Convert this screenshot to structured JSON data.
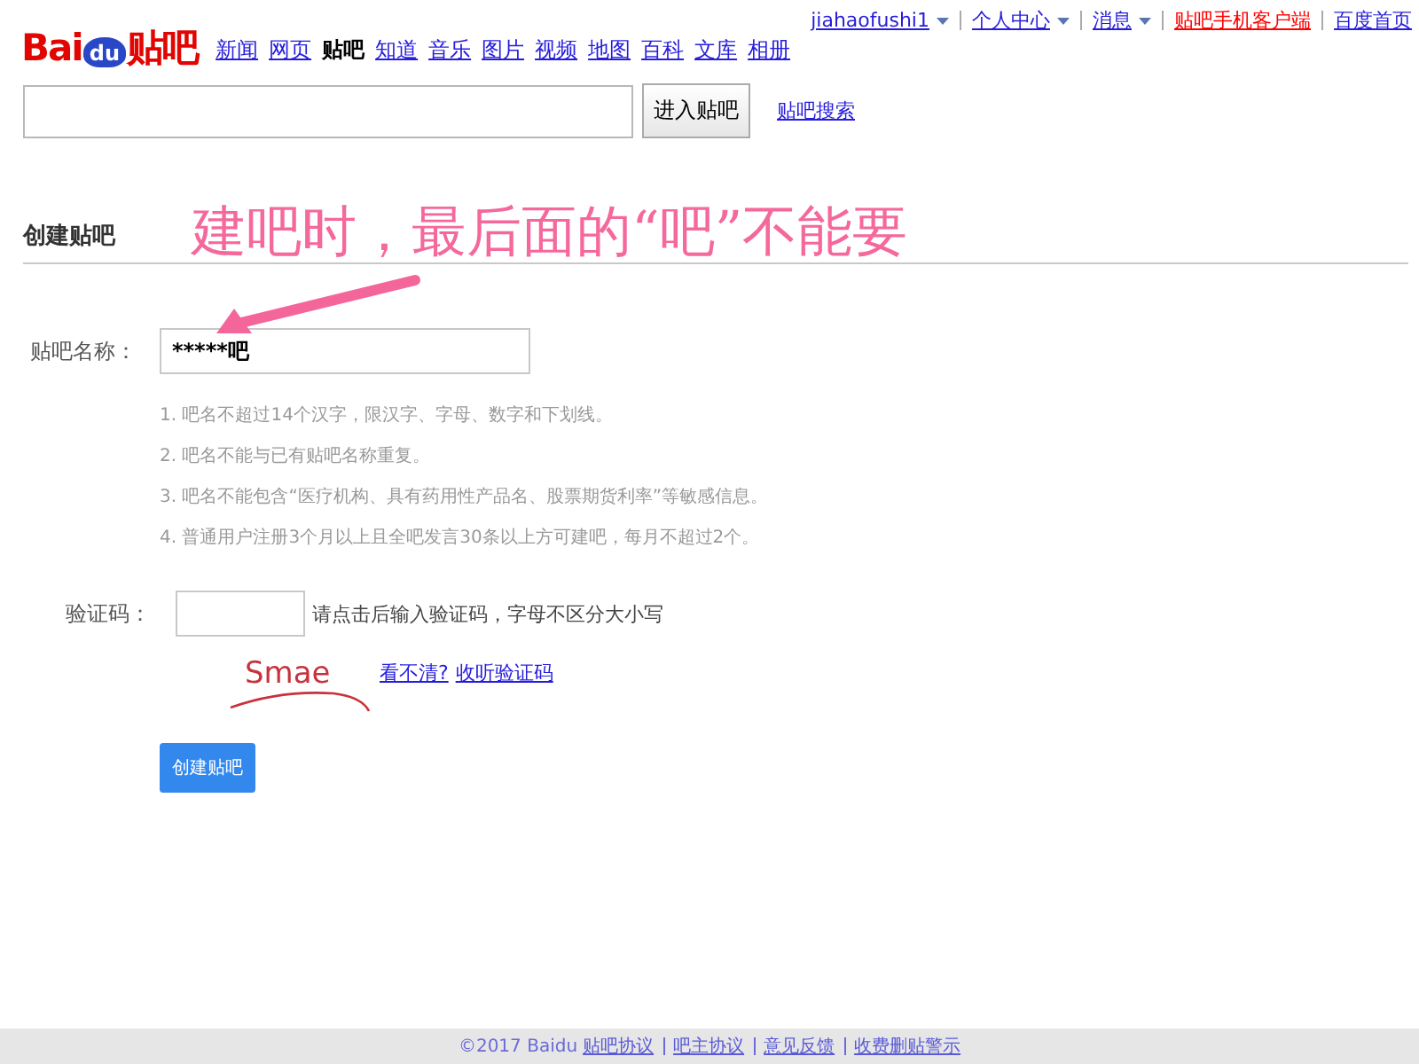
{
  "logo": {
    "left": "Bai",
    "paw": "du",
    "right": "贴吧"
  },
  "nav": [
    {
      "label": "新闻",
      "selected": false
    },
    {
      "label": "网页",
      "selected": false
    },
    {
      "label": "贴吧",
      "selected": true
    },
    {
      "label": "知道",
      "selected": false
    },
    {
      "label": "音乐",
      "selected": false
    },
    {
      "label": "图片",
      "selected": false
    },
    {
      "label": "视频",
      "selected": false
    },
    {
      "label": "地图",
      "selected": false
    },
    {
      "label": "百科",
      "selected": false
    },
    {
      "label": "文库",
      "selected": false
    },
    {
      "label": "相册",
      "selected": false
    }
  ],
  "user_bar": [
    {
      "label": "jiahaofushi1",
      "kind": "menu"
    },
    {
      "label": "个人中心",
      "kind": "menu"
    },
    {
      "label": "消息",
      "kind": "menu"
    },
    {
      "label": "贴吧手机客户端",
      "kind": "highlight"
    },
    {
      "label": "百度首页",
      "kind": "link"
    }
  ],
  "search": {
    "button": "进入贴吧",
    "link": "贴吧搜索"
  },
  "section_title": "创建贴吧",
  "annotation": "建吧时，最后面的“吧”不能要",
  "form": {
    "name_label": "贴吧名称：",
    "name_value": "*****吧",
    "hints": [
      "1. 吧名不超过14个汉字，限汉字、字母、数字和下划线。",
      "2. 吧名不能与已有贴吧名称重复。",
      "3. 吧名不能包含“医疗机构、具有药用性产品名、股票期货利率”等敏感信息。",
      "4. 普通用户注册3个月以上且全吧发言30条以上方可建吧，每月不超过2个。"
    ],
    "captcha_label": "验证码：",
    "captcha_hint": "请点击后输入验证码，字母不区分大小写",
    "captcha_text": "Smae",
    "captcha_links": [
      "看不清?",
      "收听验证码"
    ],
    "submit": "创建贴吧"
  },
  "footer": {
    "copyright": "©2017 Baidu",
    "links": [
      "贴吧协议",
      "吧主协议",
      "意见反馈",
      "收费删贴警示"
    ]
  }
}
